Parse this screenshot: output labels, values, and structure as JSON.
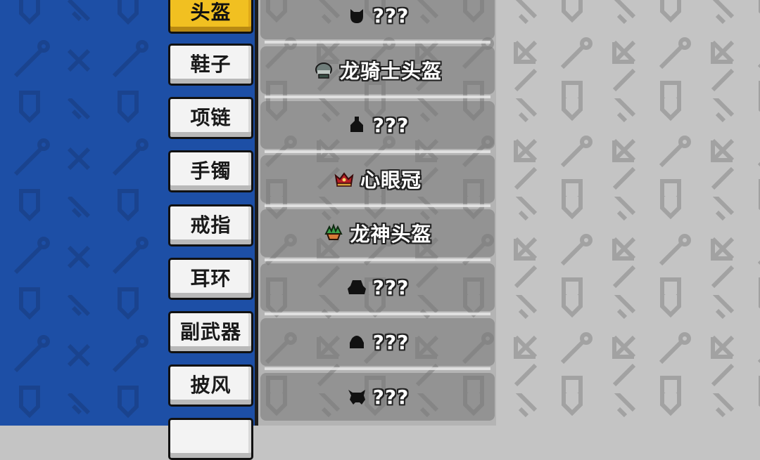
{
  "categories": [
    {
      "label": "头盔",
      "active": true
    },
    {
      "label": "鞋子",
      "active": false
    },
    {
      "label": "项链",
      "active": false
    },
    {
      "label": "手镯",
      "active": false
    },
    {
      "label": "戒指",
      "active": false
    },
    {
      "label": "耳环",
      "active": false
    },
    {
      "label": "副武器",
      "active": false
    },
    {
      "label": "披风",
      "active": false
    },
    {
      "label": "",
      "active": false
    }
  ],
  "items": [
    {
      "name": "???",
      "icon": "unknown-helmet-silhouette-icon",
      "unlocked": false
    },
    {
      "name": "龙骑士头盔",
      "icon": "dragon-knight-helmet-icon",
      "unlocked": true
    },
    {
      "name": "???",
      "icon": "unknown-hood-silhouette-icon",
      "unlocked": false
    },
    {
      "name": "心眼冠",
      "icon": "heart-eye-crown-icon",
      "unlocked": true
    },
    {
      "name": "龙神头盔",
      "icon": "dragon-god-helmet-icon",
      "unlocked": true
    },
    {
      "name": "???",
      "icon": "unknown-hat-silhouette-icon",
      "unlocked": false
    },
    {
      "name": "???",
      "icon": "unknown-cap-silhouette-icon",
      "unlocked": false
    },
    {
      "name": "???",
      "icon": "unknown-skull-silhouette-icon",
      "unlocked": false
    }
  ],
  "colors": {
    "left_bg": "#1d4fa6",
    "left_pattern": "#1a438e",
    "right_bg": "#c4c4c4",
    "right_pattern": "#9c9c9c",
    "active_tab": "#f1c021",
    "tab": "#f3f3f3"
  }
}
